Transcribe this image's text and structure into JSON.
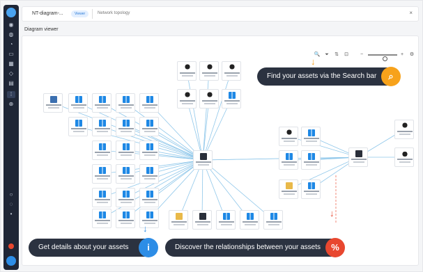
{
  "tabs": {
    "main_label": "NT-diagram-...",
    "badge": "Viewer",
    "second_label": "Network topology",
    "close_glyph": "×"
  },
  "viewer": {
    "title": "Diagram viewer"
  },
  "sidebar": {
    "items": [
      "dashboard-icon",
      "assets-icon",
      "reports-icon",
      "monitor-icon",
      "calendar-icon",
      "shield-icon",
      "tasks-icon",
      "diagram-icon",
      "settings-icon",
      "help-icon",
      "bell-icon",
      "user-icon"
    ]
  },
  "toolbar": {
    "search_glyph": "🔍",
    "filter_glyph": "⏷",
    "layout_glyph": "⇅",
    "fit_glyph": "⊡",
    "zoom_out_glyph": "−",
    "zoom_in_glyph": "+",
    "settings_glyph": "⚙",
    "zoom_level": 0.6
  },
  "callouts": {
    "search": {
      "text": "Find your assets via the Search bar",
      "glyph": "⌕",
      "color": "#f7a21b"
    },
    "details": {
      "text": "Get details about your assets",
      "glyph": "i",
      "color": "#2d8de6"
    },
    "relations": {
      "text": "Discover the relationships between your assets",
      "glyph": "%",
      "color": "#e8472f"
    }
  },
  "colors": {
    "edge": "#8fc7ea",
    "edge_dashed": "#f08a7a",
    "sidebar_bg": "#1f2636"
  }
}
